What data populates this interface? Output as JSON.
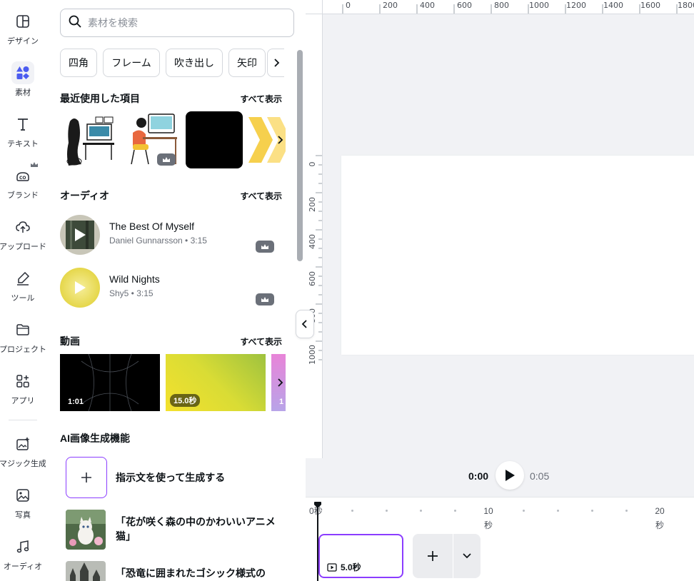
{
  "rail": {
    "items": [
      {
        "label": "デザイン",
        "icon": "layout-icon"
      },
      {
        "label": "素材",
        "icon": "shapes-icon",
        "active": true
      },
      {
        "label": "テキスト",
        "icon": "text-icon"
      },
      {
        "label": "ブランド",
        "icon": "brand-icon"
      },
      {
        "label": "アップロード",
        "icon": "cloud-upload-icon"
      },
      {
        "label": "ツール",
        "icon": "pen-tool-icon"
      },
      {
        "label": "プロジェクト",
        "icon": "folder-icon"
      },
      {
        "label": "アプリ",
        "icon": "apps-icon"
      },
      {
        "label": "マジック生成",
        "icon": "magic-image-icon"
      },
      {
        "label": "写真",
        "icon": "photo-icon"
      },
      {
        "label": "オーディオ",
        "icon": "music-icon"
      }
    ]
  },
  "search": {
    "placeholder": "素材を検索"
  },
  "chips": [
    "四角",
    "フレーム",
    "吹き出し",
    "矢印"
  ],
  "recent": {
    "title": "最近使用した項目",
    "show_all": "すべて表示"
  },
  "audio": {
    "title": "オーディオ",
    "show_all": "すべて表示",
    "tracks": [
      {
        "title": "The Best Of Myself",
        "subtitle": "Daniel Gunnarsson • 3:15"
      },
      {
        "title": "Wild Nights",
        "subtitle": "Shy5 • 3:15"
      }
    ]
  },
  "videos": {
    "title": "動画",
    "show_all": "すべて表示",
    "items": [
      {
        "duration": "1:01"
      },
      {
        "duration": "15.0秒"
      },
      {
        "duration": "1"
      }
    ]
  },
  "ai": {
    "title": "AI画像生成機能",
    "create_label": "指示文を使って生成する",
    "prompts": [
      "「花が咲く森の中のかわいいアニメ猫」",
      "「恐竜に囲まれたゴシック様式の"
    ]
  },
  "ruler_top": [
    "0",
    "200",
    "400",
    "600",
    "800",
    "1000",
    "1200",
    "1400",
    "1600",
    "1800"
  ],
  "ruler_left": [
    "0",
    "200",
    "400",
    "600",
    "800",
    "1000"
  ],
  "playback": {
    "current": "0:00",
    "total": "0:05"
  },
  "timeline": {
    "marks": [
      {
        "value": "0",
        "unit": "秒"
      },
      {
        "value": "10",
        "unit": "秒"
      },
      {
        "value": "20",
        "unit": "秒"
      }
    ],
    "clip_duration": "5.0秒"
  },
  "colors": {
    "accent": "#8b3dff",
    "rail_active": "#4c5cf0"
  }
}
